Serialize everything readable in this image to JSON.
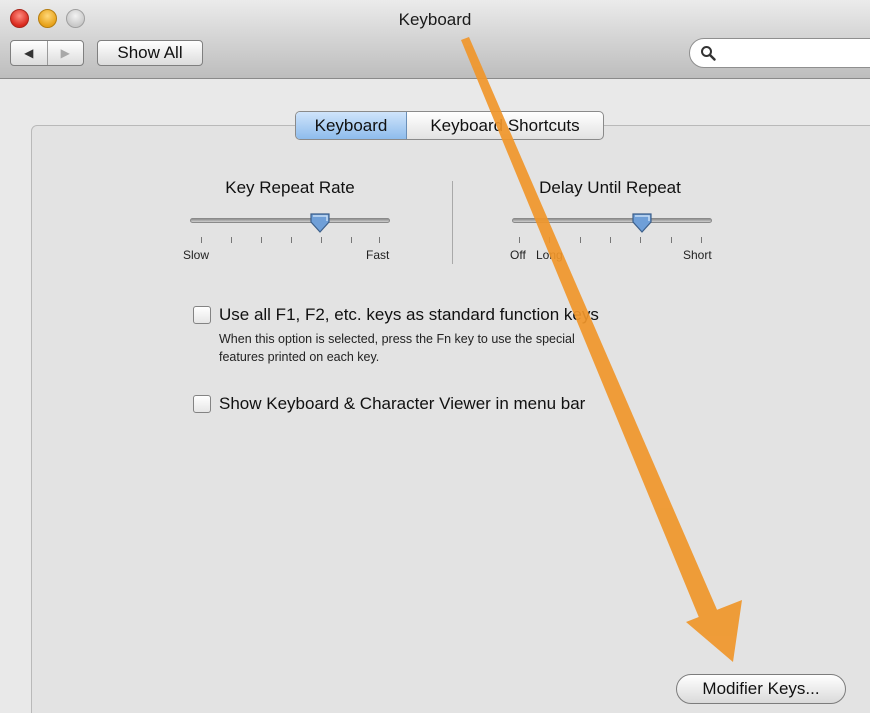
{
  "window": {
    "title": "Keyboard"
  },
  "toolbar": {
    "back_glyph": "◀",
    "forward_glyph": "▶",
    "show_all_label": "Show All",
    "search_value": "",
    "search_icon": "magnifier-icon"
  },
  "tabs": [
    {
      "label": "Keyboard",
      "selected": true
    },
    {
      "label": "Keyboard Shortcuts",
      "selected": false
    }
  ],
  "sliders": {
    "key_repeat": {
      "title": "Key Repeat Rate",
      "min_label": "Slow",
      "max_label": "Fast",
      "level": 0.65
    },
    "delay_until_repeat": {
      "title": "Delay Until Repeat",
      "min_label": "Off",
      "min_label2": "Long",
      "max_label": "Short",
      "level": 0.65
    }
  },
  "checkboxes": [
    {
      "label": "Use all F1, F2, etc. keys as standard function keys",
      "checked": false,
      "description_line1": "When this option is selected, press the Fn key to use the special",
      "description_line2": "features printed on each key."
    },
    {
      "label": "Show Keyboard & Character Viewer in menu bar",
      "checked": false
    }
  ],
  "buttons": {
    "modifier_keys": "Modifier Keys..."
  },
  "annotation": {
    "arrow_color": "#f0962a",
    "arrow_target": "modifier-keys-button"
  }
}
